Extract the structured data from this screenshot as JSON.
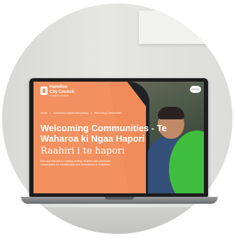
{
  "site": {
    "logo_line1": "Hamilton",
    "logo_line2": "City Council",
    "logo_tagline": "Te kaunihera o Kirikiriroa",
    "search_label": "Search"
  },
  "breadcrumb": {
    "items": [
      "Home",
      "Community support and funding",
      "Welcoming Communities"
    ],
    "separator": ">"
  },
  "hero": {
    "title": "Welcoming Communities - Te Waharoa ki Ngaa Hapori",
    "subtitle": "Raahiri i te hapori",
    "body": "Find out how we're creating healthy, resilient and connected communities for Hamiltonians and newcomers to Kirikiriroa."
  },
  "colors": {
    "brand_orange": "#f18c5a",
    "accent_green": "#3fbe3e",
    "laptop_bezel": "#1d1d1f"
  }
}
